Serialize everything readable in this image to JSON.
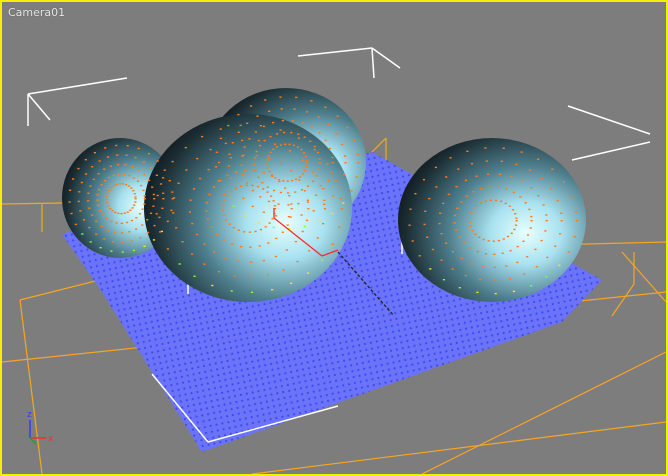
{
  "viewport": {
    "label": "Camera01"
  },
  "axis_gizmo": {
    "z_label": "z",
    "x_label": "x",
    "z_color": "#3a3aff",
    "x_color": "#ff2a2a",
    "y_color": "#20a020"
  },
  "colors": {
    "frame": "#f2f200",
    "background": "#7d7d7d",
    "grid_box": "#f5a623",
    "plane": "#5a64ff",
    "brackets": "#ffffff",
    "particles_top": "#ff7a1a"
  },
  "icons": [
    "camera-viewport-label",
    "axis-tripod-icon",
    "transform-gizmo"
  ]
}
